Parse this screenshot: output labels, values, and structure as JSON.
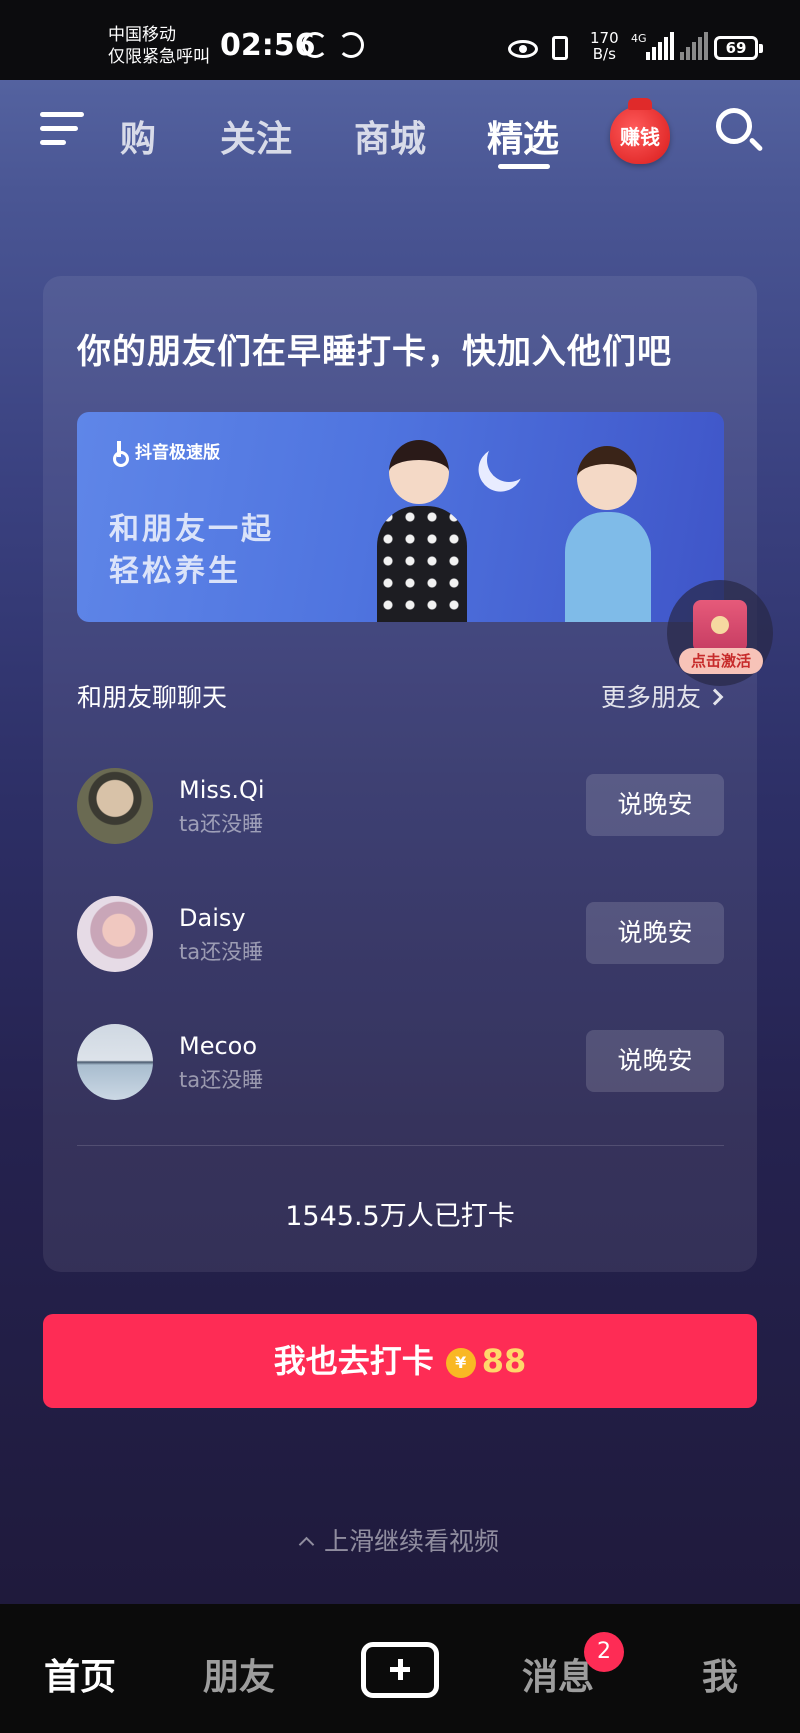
{
  "status_bar": {
    "carrier_line1": "中国移动",
    "carrier_line2": "仅限紧急呼叫",
    "time": "02:56",
    "speed_value": "170",
    "speed_unit": "B/s",
    "network": "4G",
    "battery": "69"
  },
  "top_nav": {
    "tabs": [
      {
        "label": "购"
      },
      {
        "label": "关注"
      },
      {
        "label": "商城"
      },
      {
        "label": "精选"
      }
    ],
    "active_tab": "精选",
    "earn_label": "赚钱"
  },
  "card": {
    "title": "你的朋友们在早睡打卡，快加入他们吧",
    "banner": {
      "app_name": "抖音极速版",
      "line1": "和朋友一起",
      "line2": "轻松养生"
    },
    "section_title": "和朋友聊聊天",
    "more_label": "更多朋友",
    "friends": [
      {
        "name": "Miss.Qi",
        "status": "ta还没睡",
        "action": "说晚安"
      },
      {
        "name": "Daisy",
        "status": "ta还没睡",
        "action": "说晚安"
      },
      {
        "name": "Mecoo",
        "status": "ta还没睡",
        "action": "说晚安"
      }
    ],
    "checkin_count": "1545.5万人已打卡"
  },
  "float_widget": {
    "label": "点击激活"
  },
  "cta": {
    "label": "我也去打卡",
    "coin_symbol": "¥",
    "reward": "88"
  },
  "swipe_hint": "上滑继续看视频",
  "bottom_nav": {
    "items": [
      {
        "label": "首页"
      },
      {
        "label": "朋友"
      },
      {
        "label": "消息"
      },
      {
        "label": "我"
      }
    ],
    "message_badge": "2"
  },
  "colors": {
    "accent": "#fe2c55",
    "coin": "#f9b824",
    "reward_text": "#ffd76b"
  }
}
